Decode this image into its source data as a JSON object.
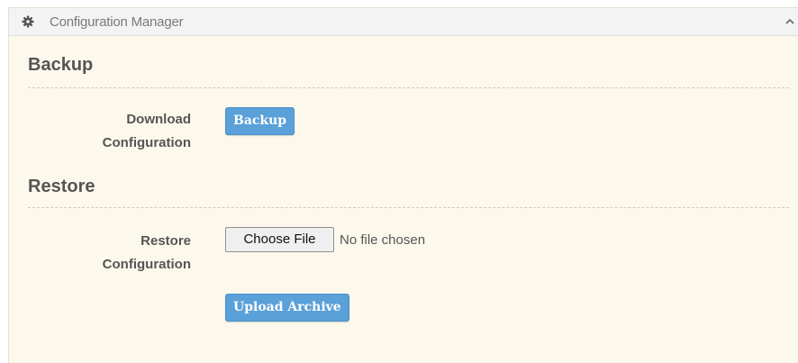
{
  "panel": {
    "title": "Configuration Manager",
    "icon": "gear-icon",
    "collapse_icon": "chevron-up-icon"
  },
  "backup": {
    "title": "Backup",
    "label_line1": "Download",
    "label_line2": "Configuration",
    "button_label": "Backup"
  },
  "restore": {
    "title": "Restore",
    "label_line1": "Restore",
    "label_line2": "Configuration",
    "choose_file_label": "Choose File",
    "file_status": "No file chosen",
    "upload_label": "Upload Archive"
  },
  "colors": {
    "panel_bg": "#fcf9ec",
    "header_bg": "#f3f3f3",
    "button_bg": "#5aa0d9",
    "label_text": "#555555"
  }
}
